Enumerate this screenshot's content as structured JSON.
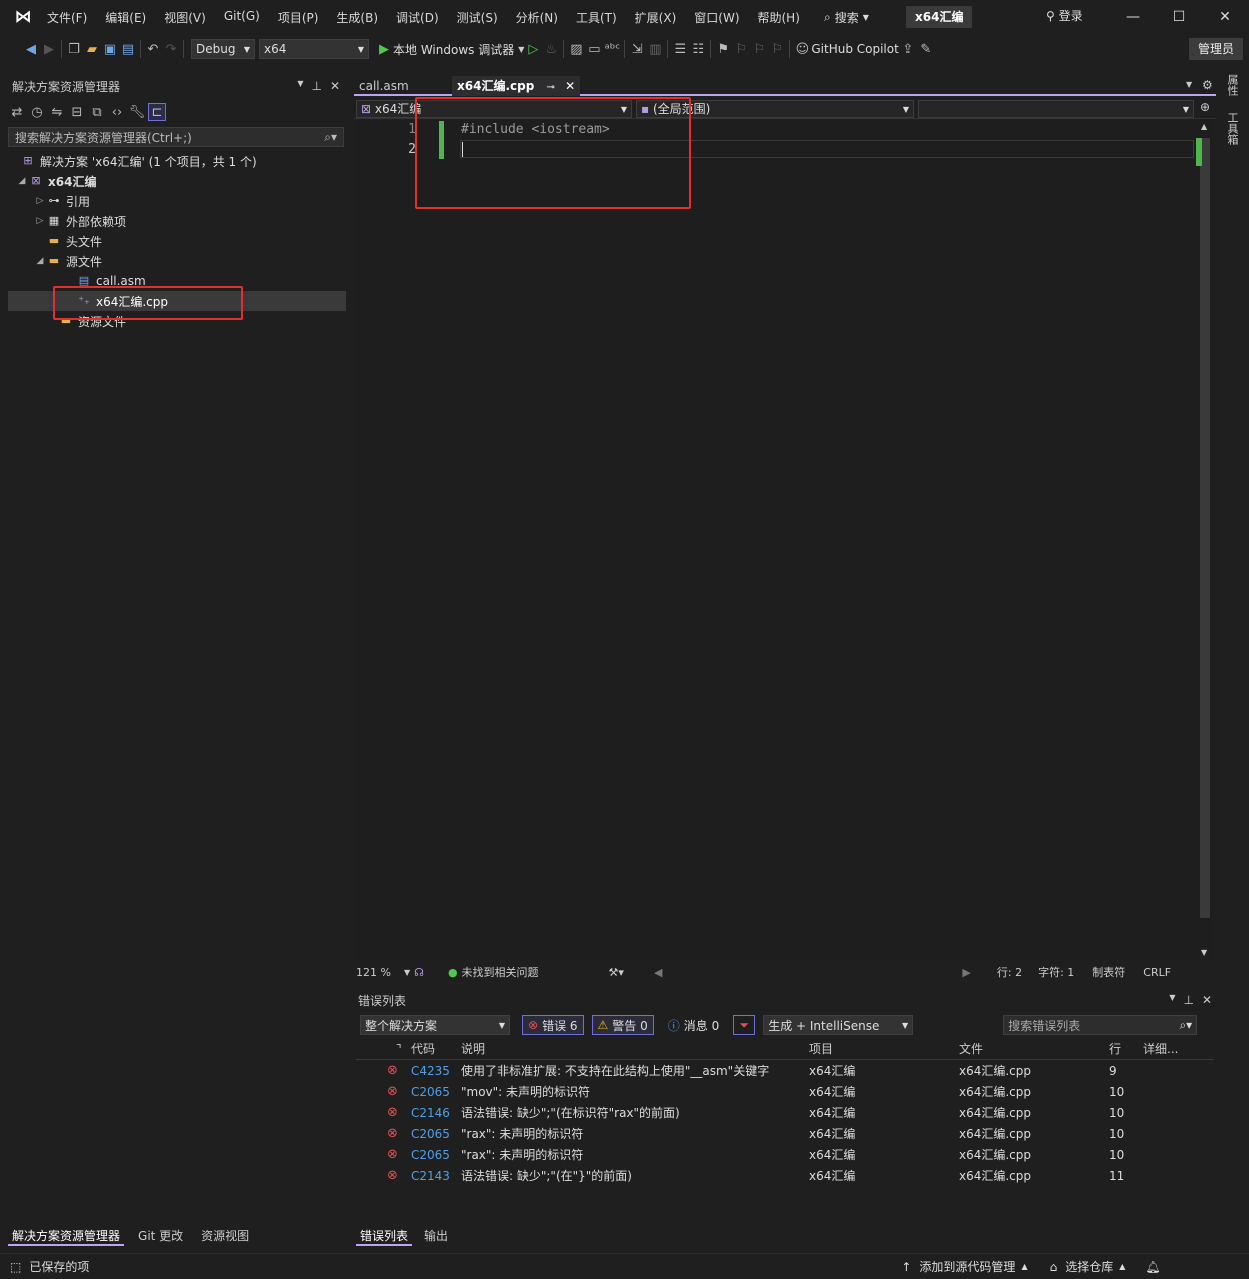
{
  "window": {
    "menus": [
      "文件(F)",
      "编辑(E)",
      "视图(V)",
      "Git(G)",
      "项目(P)",
      "生成(B)",
      "调试(D)",
      "测试(S)",
      "分析(N)",
      "工具(T)",
      "扩展(X)",
      "窗口(W)",
      "帮助(H)"
    ],
    "search": "搜索",
    "project": "x64汇编",
    "login": "登录"
  },
  "toolbar": {
    "config": "Debug",
    "platform": "x64",
    "run": "本地 Windows 调试器",
    "copilot": "GitHub Copilot",
    "admin": "管理员"
  },
  "solution": {
    "title": "解决方案资源管理器",
    "search_placeholder": "搜索解决方案资源管理器(Ctrl+;)",
    "root": "解决方案 'x64汇编' (1 个项目，共 1 个)",
    "project": "x64汇编",
    "refs": "引用",
    "ext_deps": "外部依赖项",
    "headers": "头文件",
    "sources": "源文件",
    "file_asm": "call.asm",
    "file_cpp": "x64汇编.cpp",
    "resources": "资源文件",
    "bottom_tabs": [
      "解决方案资源管理器",
      "Git 更改",
      "资源视图"
    ]
  },
  "editor": {
    "tabs": [
      "call.asm",
      "x64汇编.cpp"
    ],
    "nav_project": "x64汇编",
    "nav_scope": "(全局范围)",
    "lines": [
      "1",
      "2"
    ],
    "code_line1": "#include <iostream>",
    "zoom": "121 %",
    "issues": "未找到相关问题",
    "row": "行: 2",
    "col": "字符: 1",
    "tabs_mode": "制表符",
    "eol": "CRLF"
  },
  "errors": {
    "title": "错误列表",
    "scope": "整个解决方案",
    "err_count": "错误 6",
    "warn_count": "警告 0",
    "msg_count": "消息 0",
    "source": "生成 + IntelliSense",
    "search_placeholder": "搜索错误列表",
    "columns": [
      "代码",
      "说明",
      "项目",
      "文件",
      "行",
      "详细..."
    ],
    "rows": [
      {
        "code": "C4235",
        "desc": "使用了非标准扩展: 不支持在此结构上使用\"__asm\"关键字",
        "project": "x64汇编",
        "file": "x64汇编.cpp",
        "line": "9"
      },
      {
        "code": "C2065",
        "desc": "\"mov\": 未声明的标识符",
        "project": "x64汇编",
        "file": "x64汇编.cpp",
        "line": "10"
      },
      {
        "code": "C2146",
        "desc": "语法错误: 缺少\";\"(在标识符\"rax\"的前面)",
        "project": "x64汇编",
        "file": "x64汇编.cpp",
        "line": "10"
      },
      {
        "code": "C2065",
        "desc": "\"rax\": 未声明的标识符",
        "project": "x64汇编",
        "file": "x64汇编.cpp",
        "line": "10"
      },
      {
        "code": "C2065",
        "desc": "\"rax\": 未声明的标识符",
        "project": "x64汇编",
        "file": "x64汇编.cpp",
        "line": "10"
      },
      {
        "code": "C2143",
        "desc": "语法错误: 缺少\";\"(在\"}\"的前面)",
        "project": "x64汇编",
        "file": "x64汇编.cpp",
        "line": "11"
      }
    ],
    "bottom_tabs": [
      "错误列表",
      "输出"
    ]
  },
  "right_strip": [
    "属性",
    "工具箱"
  ],
  "status": {
    "saved": "已保存的项",
    "add_source": "添加到源代码管理",
    "select_repo": "选择仓库"
  }
}
